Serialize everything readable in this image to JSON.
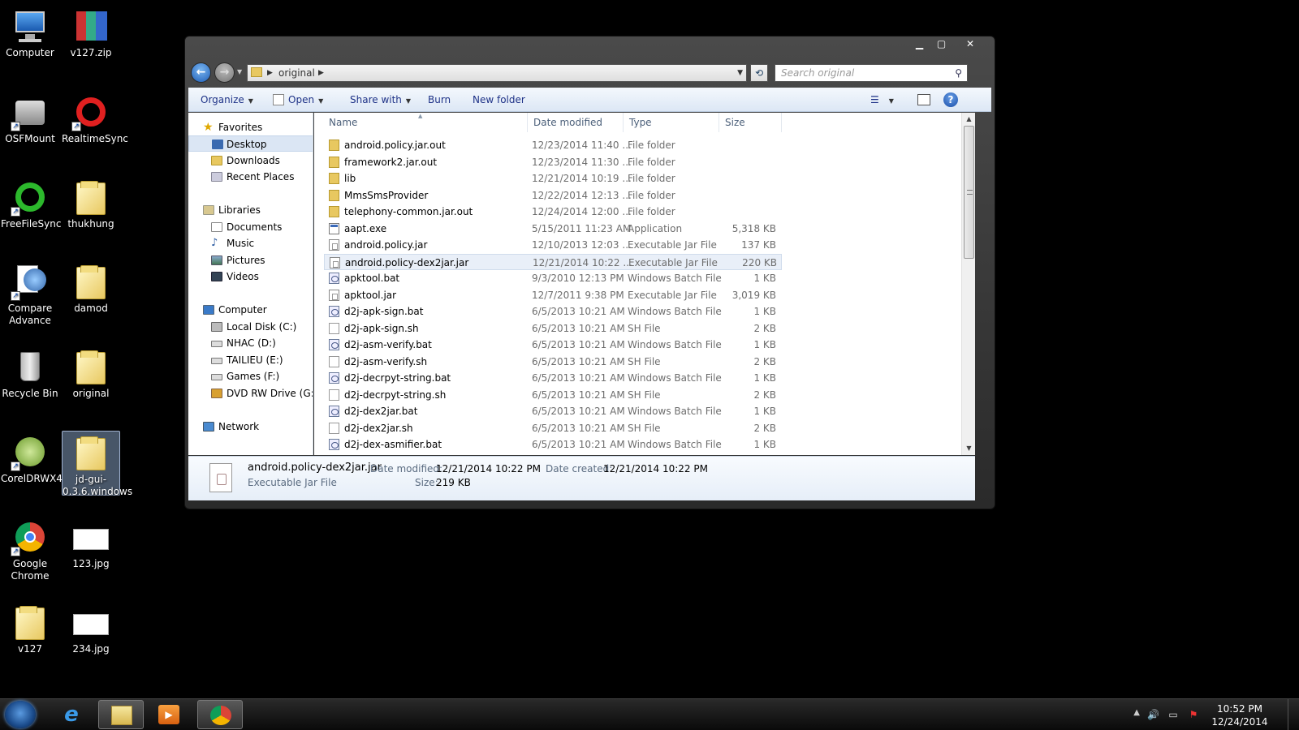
{
  "desktop": {
    "icons": [
      {
        "label": "Computer",
        "kind": "computer"
      },
      {
        "label": "v127.zip",
        "kind": "archive"
      },
      {
        "label": "OSFMount",
        "kind": "app"
      },
      {
        "label": "RealtimeSync",
        "kind": "app"
      },
      {
        "label": "FreeFileSync",
        "kind": "app"
      },
      {
        "label": "thukhung",
        "kind": "folder"
      },
      {
        "label": "Compare Advance",
        "kind": "app"
      },
      {
        "label": "damod",
        "kind": "folder"
      },
      {
        "label": "Recycle Bin",
        "kind": "recycle-bin"
      },
      {
        "label": "original",
        "kind": "folder"
      },
      {
        "label": "CorelDRWX4",
        "kind": "app"
      },
      {
        "label": "jd-gui-0.3.6.windows",
        "kind": "folder"
      },
      {
        "label": "Google Chrome",
        "kind": "app"
      },
      {
        "label": "123.jpg",
        "kind": "image"
      },
      {
        "label": "v127",
        "kind": "folder"
      },
      {
        "label": "234.jpg",
        "kind": "image"
      }
    ]
  },
  "window": {
    "address": {
      "path": "original"
    },
    "search_placeholder": "Search original",
    "caption": {
      "minimize": "▁",
      "maximize": "▢",
      "close": "✕"
    },
    "toolbar": {
      "organize": "Organize",
      "open": "Open",
      "share": "Share with",
      "burn": "Burn",
      "new_folder": "New folder"
    },
    "nav": {
      "favorites": "Favorites",
      "fav_items": [
        "Desktop",
        "Downloads",
        "Recent Places"
      ],
      "libraries": "Libraries",
      "lib_items": [
        "Documents",
        "Music",
        "Pictures",
        "Videos"
      ],
      "computer": "Computer",
      "comp_items": [
        "Local Disk (C:)",
        "NHAC (D:)",
        "TAILIEU (E:)",
        "Games (F:)",
        "DVD RW Drive (G:) S"
      ],
      "network": "Network"
    },
    "columns": {
      "name": "Name",
      "date": "Date modified",
      "type": "Type",
      "size": "Size"
    },
    "files": [
      {
        "name": "android.policy.jar.out",
        "date": "12/23/2014 11:40 ...",
        "type": "File folder",
        "size": "",
        "icon": "folder"
      },
      {
        "name": "framework2.jar.out",
        "date": "12/23/2014 11:30 ...",
        "type": "File folder",
        "size": "",
        "icon": "folder"
      },
      {
        "name": "lib",
        "date": "12/21/2014 10:19 ...",
        "type": "File folder",
        "size": "",
        "icon": "folder"
      },
      {
        "name": "MmsSmsProvider",
        "date": "12/22/2014 12:13 ...",
        "type": "File folder",
        "size": "",
        "icon": "folder"
      },
      {
        "name": "telephony-common.jar.out",
        "date": "12/24/2014 12:00 ...",
        "type": "File folder",
        "size": "",
        "icon": "folder"
      },
      {
        "name": "aapt.exe",
        "date": "5/15/2011 11:23 AM",
        "type": "Application",
        "size": "5,318 KB",
        "icon": "app"
      },
      {
        "name": "android.policy.jar",
        "date": "12/10/2013 12:03 ...",
        "type": "Executable Jar File",
        "size": "137 KB",
        "icon": "jar"
      },
      {
        "name": "android.policy-dex2jar.jar",
        "date": "12/21/2014 10:22 ...",
        "type": "Executable Jar File",
        "size": "220 KB",
        "icon": "jar"
      },
      {
        "name": "apktool.bat",
        "date": "9/3/2010 12:13 PM",
        "type": "Windows Batch File",
        "size": "1 KB",
        "icon": "bat"
      },
      {
        "name": "apktool.jar",
        "date": "12/7/2011 9:38 PM",
        "type": "Executable Jar File",
        "size": "3,019 KB",
        "icon": "jar"
      },
      {
        "name": "d2j-apk-sign.bat",
        "date": "6/5/2013 10:21 AM",
        "type": "Windows Batch File",
        "size": "1 KB",
        "icon": "bat"
      },
      {
        "name": "d2j-apk-sign.sh",
        "date": "6/5/2013 10:21 AM",
        "type": "SH File",
        "size": "2 KB",
        "icon": "sh"
      },
      {
        "name": "d2j-asm-verify.bat",
        "date": "6/5/2013 10:21 AM",
        "type": "Windows Batch File",
        "size": "1 KB",
        "icon": "bat"
      },
      {
        "name": "d2j-asm-verify.sh",
        "date": "6/5/2013 10:21 AM",
        "type": "SH File",
        "size": "2 KB",
        "icon": "sh"
      },
      {
        "name": "d2j-decrpyt-string.bat",
        "date": "6/5/2013 10:21 AM",
        "type": "Windows Batch File",
        "size": "1 KB",
        "icon": "bat"
      },
      {
        "name": "d2j-decrpyt-string.sh",
        "date": "6/5/2013 10:21 AM",
        "type": "SH File",
        "size": "2 KB",
        "icon": "sh"
      },
      {
        "name": "d2j-dex2jar.bat",
        "date": "6/5/2013 10:21 AM",
        "type": "Windows Batch File",
        "size": "1 KB",
        "icon": "bat"
      },
      {
        "name": "d2j-dex2jar.sh",
        "date": "6/5/2013 10:21 AM",
        "type": "SH File",
        "size": "2 KB",
        "icon": "sh"
      },
      {
        "name": "d2j-dex-asmifier.bat",
        "date": "6/5/2013 10:21 AM",
        "type": "Windows Batch File",
        "size": "1 KB",
        "icon": "bat"
      }
    ],
    "details": {
      "name": "android.policy-dex2jar.jar",
      "type": "Executable Jar File",
      "modified_label": "Date modified:",
      "modified": "12/21/2014 10:22 PM",
      "created_label": "Date created:",
      "created": "12/21/2014 10:22 PM",
      "size_label": "Size:",
      "size": "219 KB"
    }
  },
  "taskbar": {
    "time": "10:52 PM",
    "date": "12/24/2014",
    "pinned": [
      "internet-explorer",
      "windows-explorer",
      "media-player",
      "google-chrome"
    ]
  }
}
